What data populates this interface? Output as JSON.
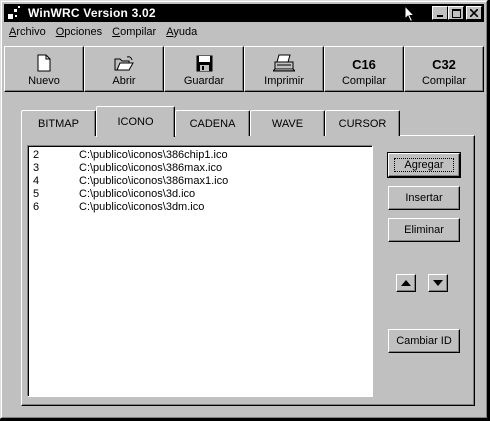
{
  "window": {
    "title": "WinWRC Version 3.02"
  },
  "title_buttons": {
    "minimize": "_",
    "maximize": "□",
    "close": "×"
  },
  "menu": [
    {
      "label_u": "A",
      "label_rest": "rchivo"
    },
    {
      "label_u": "O",
      "label_rest": "pciones"
    },
    {
      "label_u": "C",
      "label_rest": "ompilar"
    },
    {
      "label_u": "A",
      "label_rest": "yuda"
    }
  ],
  "toolbar": [
    {
      "icon": "new-document-icon",
      "label": "Nuevo"
    },
    {
      "icon": "open-folder-icon",
      "label": "Abrir"
    },
    {
      "icon": "floppy-disk-icon",
      "label": "Guardar"
    },
    {
      "icon": "printer-icon",
      "label": "Imprimir"
    },
    {
      "big": "C16",
      "label": "Compilar"
    },
    {
      "big": "C32",
      "label": "Compilar"
    }
  ],
  "tabs": [
    {
      "label": "BITMAP"
    },
    {
      "label": "ICONO",
      "active": true
    },
    {
      "label": "CADENA"
    },
    {
      "label": "WAVE"
    },
    {
      "label": "CURSOR"
    }
  ],
  "list": [
    {
      "id": "2",
      "path": "C:\\publico\\iconos\\386chip1.ico"
    },
    {
      "id": "3",
      "path": "C:\\publico\\iconos\\386max.ico"
    },
    {
      "id": "4",
      "path": "C:\\publico\\iconos\\386max1.ico"
    },
    {
      "id": "5",
      "path": "C:\\publico\\iconos\\3d.ico"
    },
    {
      "id": "6",
      "path": "C:\\publico\\iconos\\3dm.ico"
    }
  ],
  "buttons": {
    "agregar": "Agregar",
    "insertar": "Insertar",
    "eliminar": "Eliminar",
    "cambiar_id": "Cambiar ID"
  }
}
